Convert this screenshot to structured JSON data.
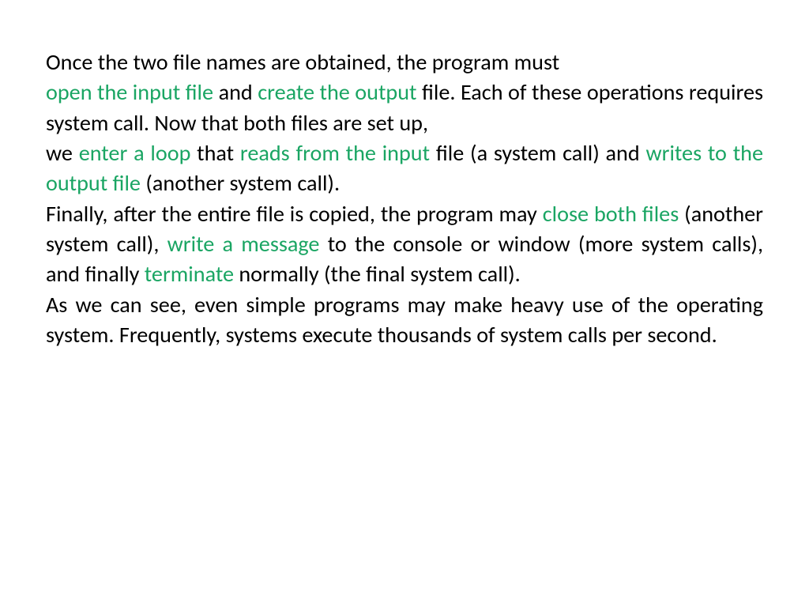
{
  "colors": {
    "highlight": "#1aa563",
    "text": "#000000"
  },
  "p1": {
    "t1": "Once the two file names are obtained, the program must"
  },
  "p2": {
    "lead_space": " ",
    "h1": "open the input file",
    "t1": " and ",
    "h2": "create the output",
    "t2": " file. Each of these operations requires system call. Now that both files are set up,"
  },
  "p3": {
    "t1": "we ",
    "h1": "enter a loop",
    "t2": " that ",
    "h2": "reads from the input",
    "t3": " file (a system call) and ",
    "h3": "writes to the output file",
    "t4": " (another system call)."
  },
  "p4": {
    "t1": " Finally, after the entire file is copied, the program may ",
    "h1": "close both files",
    "t2": " (another system call), ",
    "h2": "write a message",
    "t3": " to the console or window (more system calls), and finally ",
    "h3": "terminate",
    "t4": " normally (the final system call)."
  },
  "p5": {
    "t1": "As we can see, even simple programs may make heavy use of the operating system. Frequently, systems execute thousands of system calls per second."
  }
}
